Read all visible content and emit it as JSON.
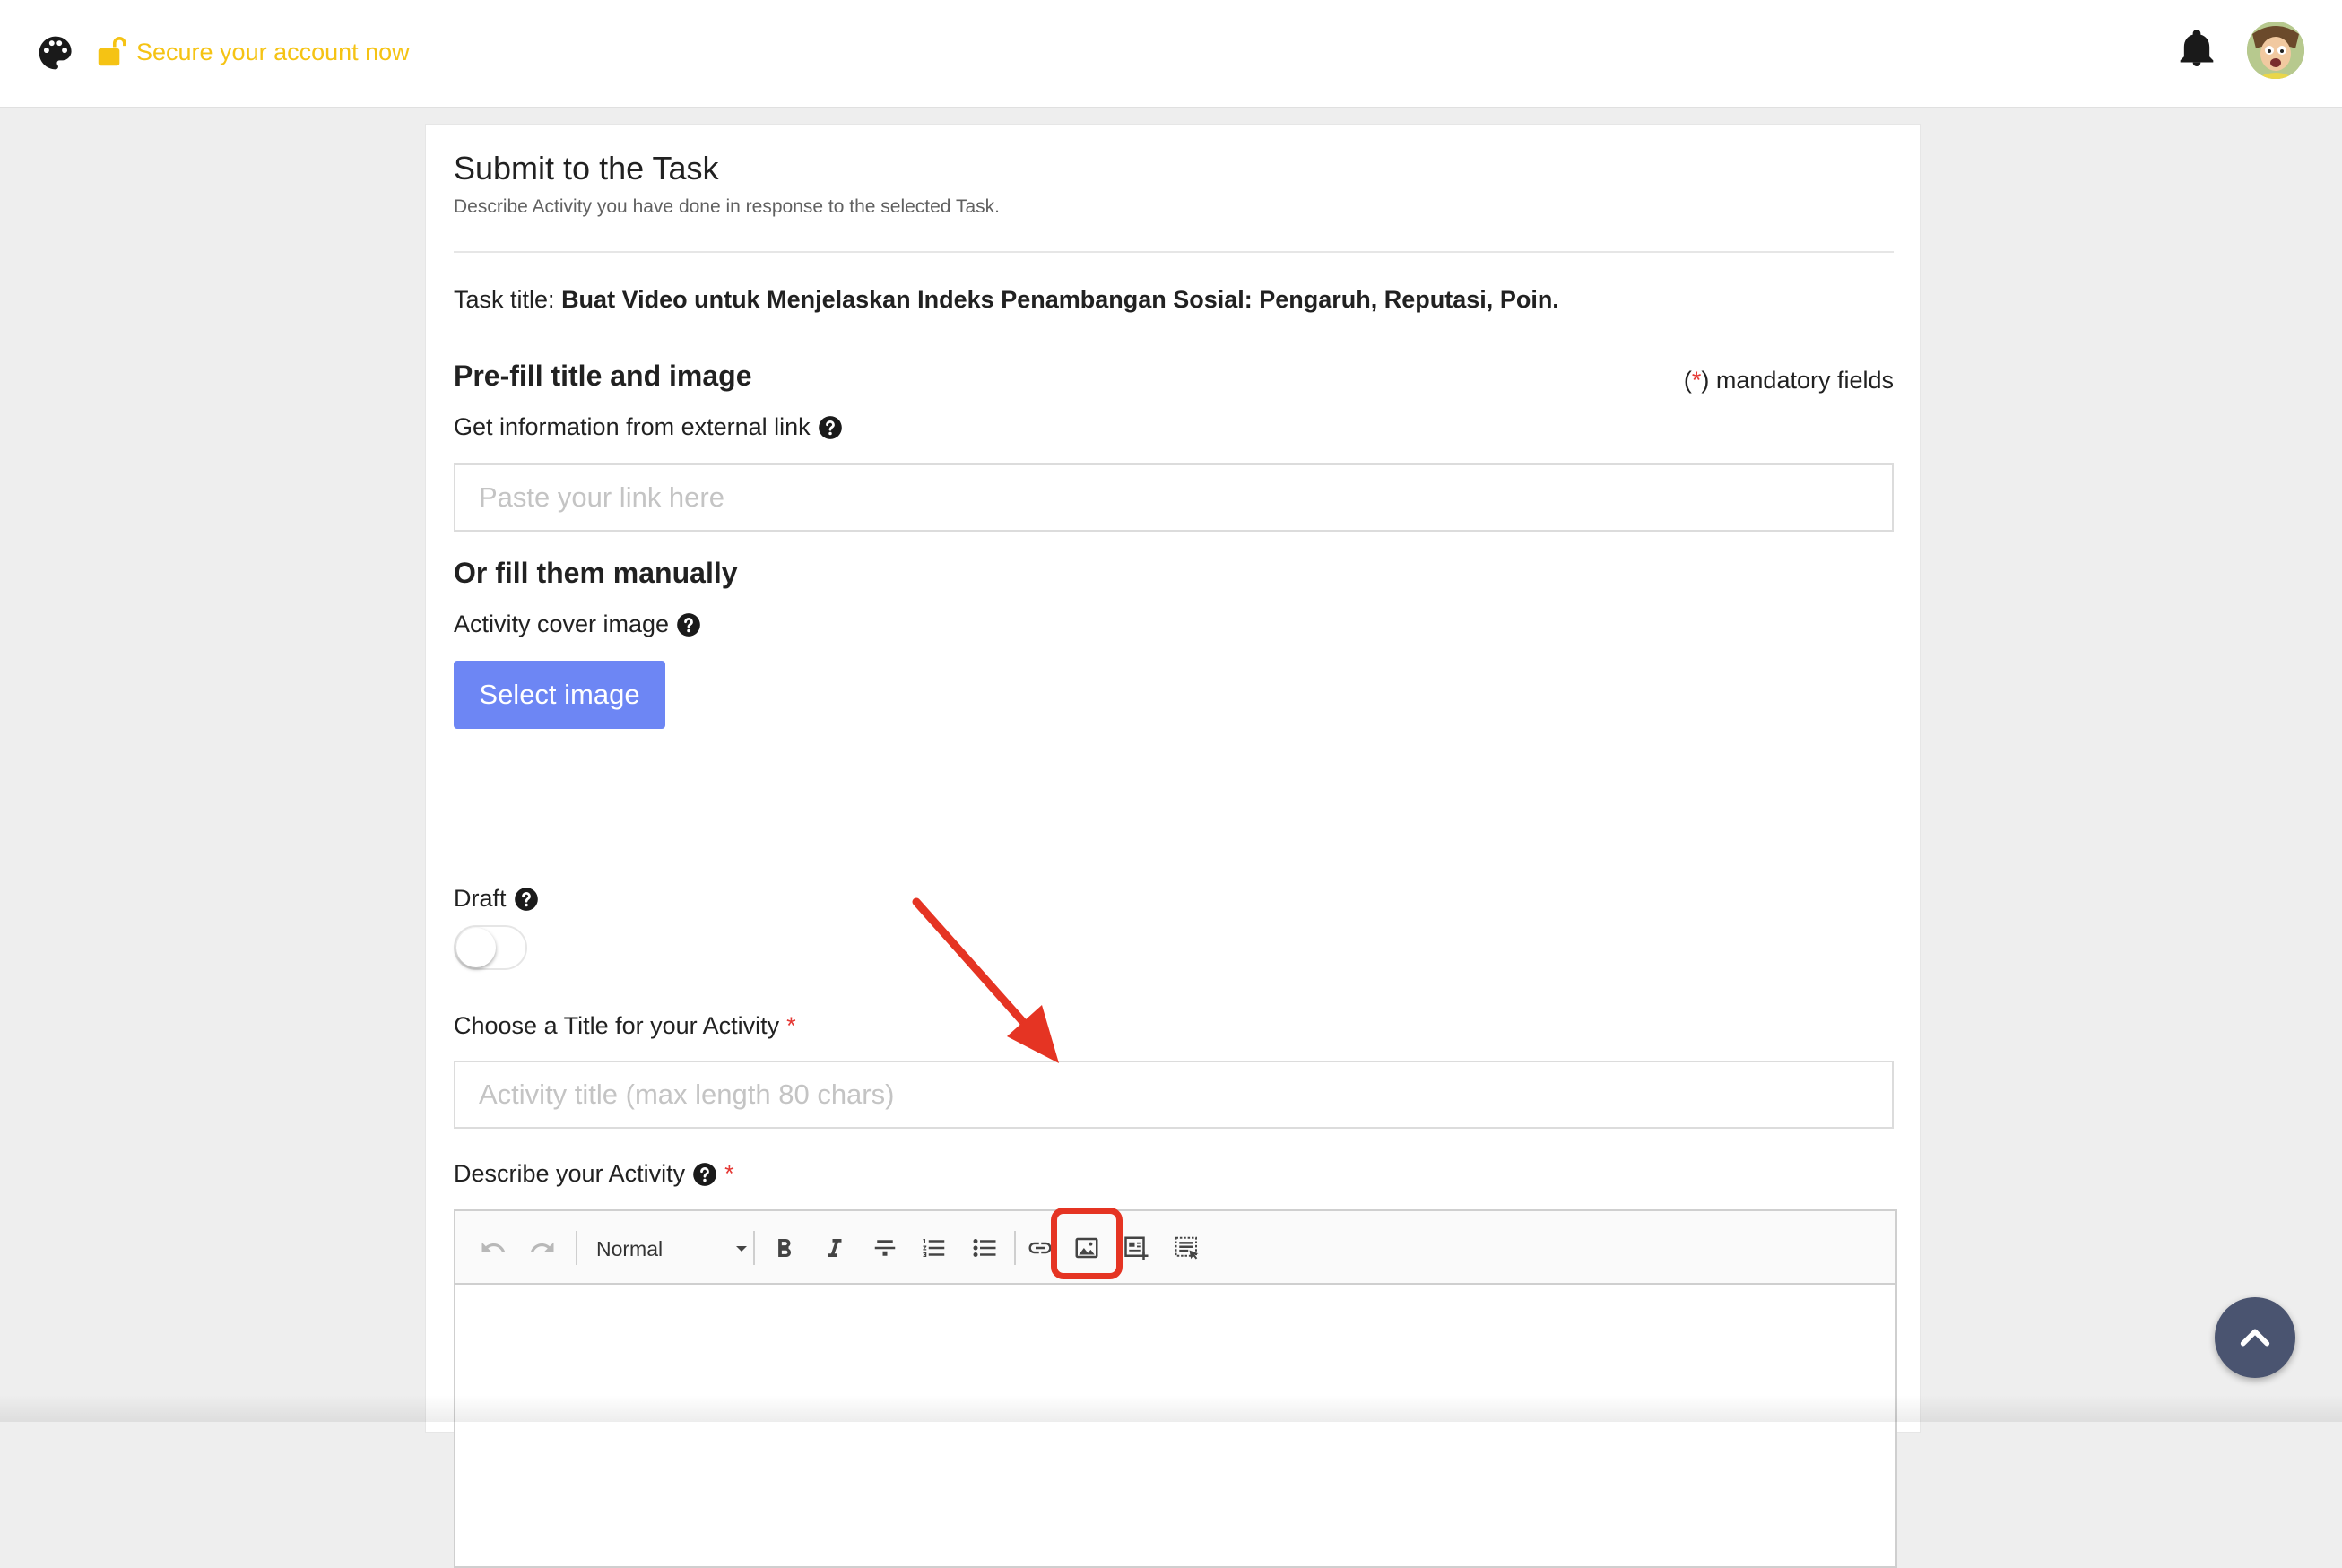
{
  "header": {
    "secure_label": "Secure your account now",
    "icons": [
      "palette-icon",
      "lock-open-icon",
      "bell-icon",
      "avatar"
    ],
    "accent_color": "#f5c314"
  },
  "form": {
    "title": "Submit to the Task",
    "subtitle": "Describe Activity you have done in response to the selected Task.",
    "task_label": "Task title:",
    "task_title": "Buat Video untuk Menjelaskan Indeks Penambangan Sosial: Pengaruh, Reputasi, Poin.",
    "prefill_heading": "Pre-fill title and image",
    "mandatory_open": "(",
    "mandatory_star": "*",
    "mandatory_close": ") mandatory fields",
    "external_link_label": "Get information from external link",
    "external_link_placeholder": "Paste your link here",
    "manual_heading": "Or fill them manually",
    "cover_label": "Activity cover image",
    "select_image_label": "Select image",
    "draft_label": "Draft",
    "draft_on": false,
    "title_label": "Choose a Title for your Activity",
    "title_required": "*",
    "title_placeholder": "Activity title (max length 80 chars)",
    "describe_label": "Describe your Activity",
    "describe_required": "*",
    "primary_color": "#6d86f4",
    "required_color": "#e53935"
  },
  "editor": {
    "format_value": "Normal",
    "toolbar_icons": [
      "undo-icon",
      "redo-icon",
      "bold-icon",
      "italic-icon",
      "strikethrough-icon",
      "ordered-list-icon",
      "bullet-list-icon",
      "link-icon",
      "image-icon",
      "insert-embed-icon",
      "select-all-icon"
    ],
    "highlighted_tool": "image-icon",
    "highlight_color": "#e53423"
  }
}
